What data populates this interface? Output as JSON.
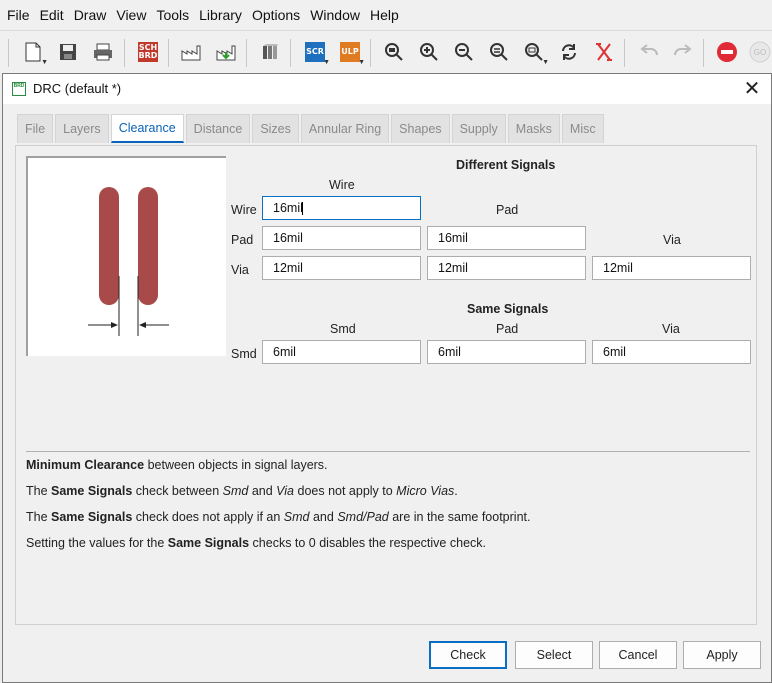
{
  "menu": [
    "File",
    "Edit",
    "Draw",
    "View",
    "Tools",
    "Library",
    "Options",
    "Window",
    "Help"
  ],
  "toolbar": {
    "sch_brd_label": "SCH BRD",
    "scr_label": "SCR",
    "ulp_label": "ULP",
    "go_label": "GO"
  },
  "dialog": {
    "app_icon_label": "BRD",
    "title": "DRC (default *)",
    "tabs": [
      "File",
      "Layers",
      "Clearance",
      "Distance",
      "Sizes",
      "Annular Ring",
      "Shapes",
      "Supply",
      "Masks",
      "Misc"
    ],
    "active_tab": "Clearance",
    "different_signals": {
      "heading": "Different Signals",
      "col_wire": "Wire",
      "col_pad": "Pad",
      "col_via": "Via",
      "row_wire": "Wire",
      "row_pad": "Pad",
      "row_via": "Via",
      "wire_wire": "16mil",
      "pad_wire": "16mil",
      "pad_pad": "16mil",
      "via_wire": "12mil",
      "via_pad": "12mil",
      "via_via": "12mil"
    },
    "same_signals": {
      "heading": "Same Signals",
      "col_smd": "Smd",
      "col_pad": "Pad",
      "col_via": "Via",
      "row_smd": "Smd",
      "smd_smd": "6mil",
      "smd_pad": "6mil",
      "smd_via": "6mil"
    },
    "description": {
      "line1_bold": "Minimum Clearance",
      "line1_rest": " between objects in signal layers.",
      "line2_a": "The ",
      "line2_bold": "Same Signals",
      "line2_b": " check between ",
      "line2_i1": "Smd",
      "line2_c": " and ",
      "line2_i2": "Via",
      "line2_d": " does not apply to ",
      "line2_i3": "Micro Vias",
      "line2_e": ".",
      "line3_a": "The ",
      "line3_bold": "Same Signals",
      "line3_b": " check does not apply if an ",
      "line3_i1": "Smd",
      "line3_c": " and ",
      "line3_i2": "Smd/Pad",
      "line3_d": " are in the same footprint.",
      "line4_a": "Setting the values for the ",
      "line4_bold": "Same Signals",
      "line4_b": " checks to 0 disables the respective check."
    },
    "buttons": {
      "check": "Check",
      "select": "Select",
      "cancel": "Cancel",
      "apply": "Apply"
    }
  },
  "colors": {
    "accent": "#0a6ec4",
    "wire_preview": "#a84a4a",
    "tab_active_text": "#0a63b8"
  }
}
